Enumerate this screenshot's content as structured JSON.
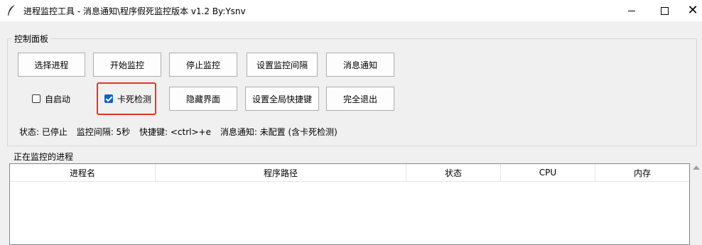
{
  "window": {
    "title": "进程监控工具 - 消息通知\\程序假死监控版本 v1.2    By:Ysnv",
    "close_glyph": "✕"
  },
  "control_panel": {
    "title": "控制面板",
    "buttons": {
      "select_process": "选择进程",
      "start_monitor": "开始监控",
      "stop_monitor": "停止监控",
      "set_interval": "设置监控间隔",
      "notification": "消息通知",
      "hide_ui": "隐藏界面",
      "set_hotkey": "设置全局快捷键",
      "exit": "完全退出"
    },
    "checkboxes": {
      "autostart": {
        "label": "自启动",
        "checked": false
      },
      "freeze_detect": {
        "label": "卡死检测",
        "checked": true
      }
    },
    "status": {
      "state": "状态: 已停止",
      "interval": "监控间隔: 5秒",
      "hotkey": "快捷键: <ctrl>+e",
      "notify": "消息通知: 未配置 (含卡死检测)"
    }
  },
  "process_list": {
    "title": "正在监控的进程",
    "columns": [
      "进程名",
      "程序路径",
      "状态",
      "CPU",
      "内存"
    ]
  },
  "colors": {
    "highlight": "#e8322b",
    "checkbox_checked": "#0b61c4"
  }
}
